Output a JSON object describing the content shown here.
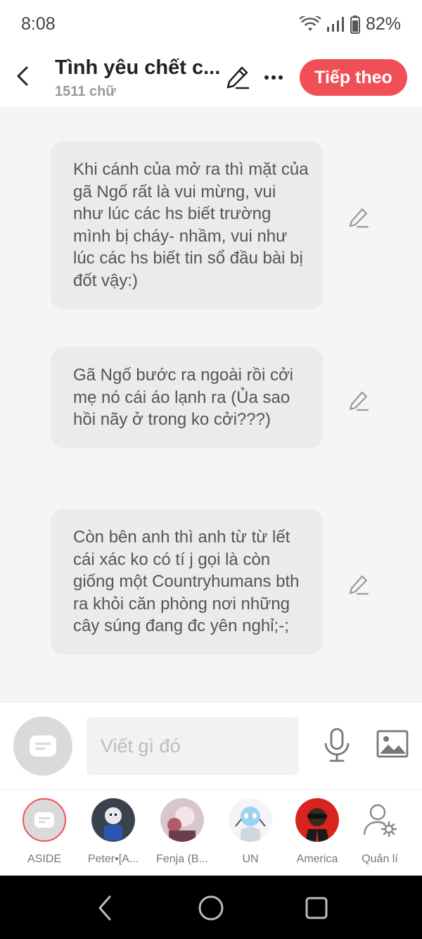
{
  "status": {
    "time": "8:08",
    "battery": "82%"
  },
  "header": {
    "title": "Tình yêu chết c...",
    "word_count": "1511 chữ",
    "next_label": "Tiếp theo"
  },
  "messages": [
    "Khi cánh của mở ra thì mặt của gã Ngố rất là vui mừng, vui như lúc các hs biết trường mình bị cháy- nhầm, vui như lúc các hs biết tin sổ đầu bài bị đốt vậy:)",
    "Gã Ngố bước ra ngoài rồi cởi mẹ nó cái áo lạnh ra (Ủa sao hồi nãy ở trong ko cởi???)",
    "Còn bên anh thì anh từ từ lết cái xác ko có tí j gọi là còn giống một Countryhumans bth ra khỏi căn phòng nơi những cây súng đang đc yên nghỉ;-;"
  ],
  "composer": {
    "placeholder": "Viết gì đó"
  },
  "characters": [
    {
      "name": "ASIDE"
    },
    {
      "name": "Peter•[A..."
    },
    {
      "name": "Fenja (B..."
    },
    {
      "name": "UN"
    },
    {
      "name": "America"
    },
    {
      "name": "Quản lí"
    }
  ],
  "colors": {
    "accent": "#f05055",
    "bubble": "#ebebeb",
    "background": "#f5f5f5"
  }
}
